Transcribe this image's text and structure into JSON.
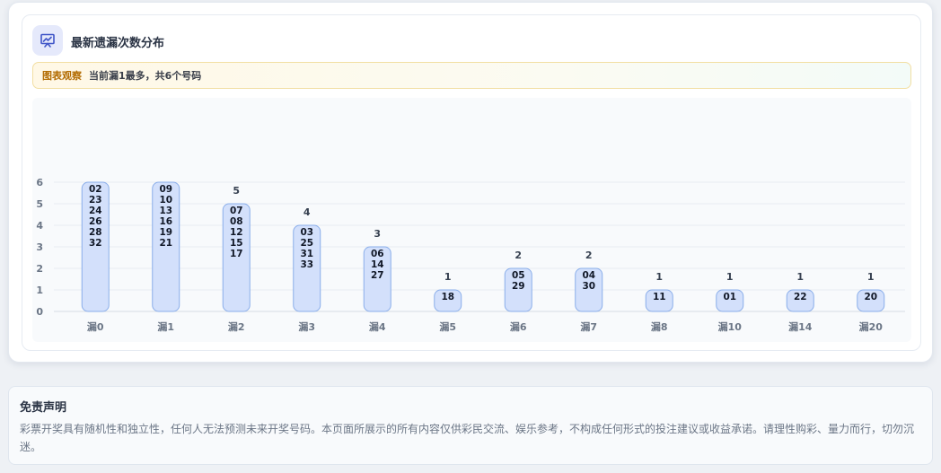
{
  "header": {
    "title": "最新遗漏次数分布",
    "icon": "chart-presentation-icon"
  },
  "observation": {
    "tag": "图表观察",
    "text": "当前漏1最多，共6个号码"
  },
  "chart_data": {
    "type": "bar",
    "categories": [
      "漏0",
      "漏1",
      "漏2",
      "漏3",
      "漏4",
      "漏5",
      "漏6",
      "漏7",
      "漏8",
      "漏10",
      "漏14",
      "漏20"
    ],
    "values": [
      6,
      6,
      5,
      4,
      3,
      1,
      2,
      2,
      1,
      1,
      1,
      1
    ],
    "numbers": [
      [
        "02",
        "23",
        "24",
        "26",
        "28",
        "32"
      ],
      [
        "09",
        "10",
        "13",
        "16",
        "19",
        "21"
      ],
      [
        "07",
        "08",
        "12",
        "15",
        "17"
      ],
      [
        "03",
        "25",
        "31",
        "33"
      ],
      [
        "06",
        "14",
        "27"
      ],
      [
        "18"
      ],
      [
        "05",
        "29"
      ],
      [
        "04",
        "30"
      ],
      [
        "11"
      ],
      [
        "01"
      ],
      [
        "22"
      ],
      [
        "20"
      ]
    ],
    "ylim": [
      0,
      6
    ],
    "yticks": [
      "0",
      "1",
      "2",
      "3",
      "4",
      "5",
      "6"
    ],
    "grid": true,
    "bar_color": "#d3e0fb",
    "bar_border": "#8aaeea"
  },
  "disclaimer": {
    "title": "免责声明",
    "text": "彩票开奖具有随机性和独立性，任何人无法预测未来开奖号码。本页面所展示的所有内容仅供彩民交流、娱乐参考，不构成任何形式的投注建议或收益承诺。请理性购彩、量力而行，切勿沉迷。"
  }
}
